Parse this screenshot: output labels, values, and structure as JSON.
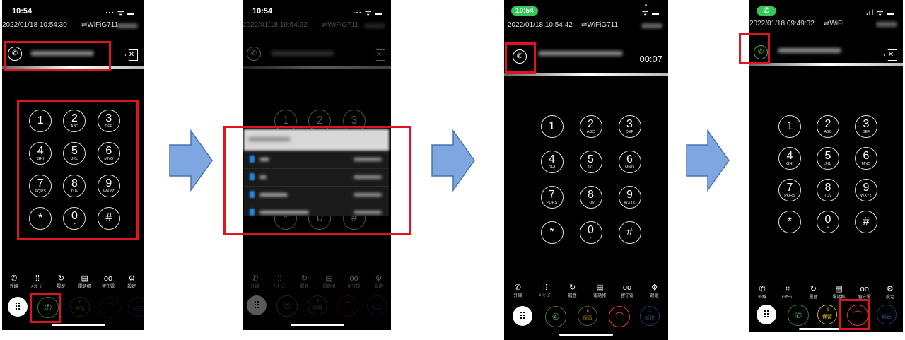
{
  "keypad": [
    {
      "digit": "1",
      "letters": ""
    },
    {
      "digit": "2",
      "letters": "ABC"
    },
    {
      "digit": "3",
      "letters": "DEF"
    },
    {
      "digit": "4",
      "letters": "GHI"
    },
    {
      "digit": "5",
      "letters": "JKL"
    },
    {
      "digit": "6",
      "letters": "MNO"
    },
    {
      "digit": "7",
      "letters": "PQRS"
    },
    {
      "digit": "8",
      "letters": "TUV"
    },
    {
      "digit": "9",
      "letters": "WXYZ"
    },
    {
      "digit": "*",
      "letters": ""
    },
    {
      "digit": "0",
      "letters": "+"
    },
    {
      "digit": "#",
      "letters": ""
    }
  ],
  "tabs": [
    {
      "icon": "phone-icon",
      "label": "外線"
    },
    {
      "icon": "message-icon",
      "label": "ﾒｯｾｰｼﾞ"
    },
    {
      "icon": "history-icon",
      "label": "履歴"
    },
    {
      "icon": "phonebook-icon",
      "label": "電話帳"
    },
    {
      "icon": "voicemail-icon",
      "label": "留守電"
    },
    {
      "icon": "gear-icon",
      "label": "設定"
    }
  ],
  "actions": {
    "hold_label": "保留",
    "transfer_label": "転送"
  },
  "colors": {
    "highlight_red": "#e0141e",
    "arrow_fill": "#7ea6e0",
    "arrow_stroke": "#4a72b0",
    "call_green": "#4caf50",
    "hangup_red": "#ff3b30"
  },
  "screens": [
    {
      "status_time": "10:54",
      "datetime": "2022/01/18 10:54:30",
      "network": "⇌WiFiG711"
    },
    {
      "status_time": "10:54",
      "datetime": "2022/01/18 10:54:22",
      "network": "⇌WiFiG711"
    },
    {
      "status_time": "10:54",
      "datetime": "2022/01/18 10:54:42",
      "network": "⇌WiFiG711",
      "call_timer": "00:07"
    },
    {
      "status_time": "",
      "datetime": "2022/01/18 09:49:32",
      "network": "⇌WiFi"
    }
  ]
}
